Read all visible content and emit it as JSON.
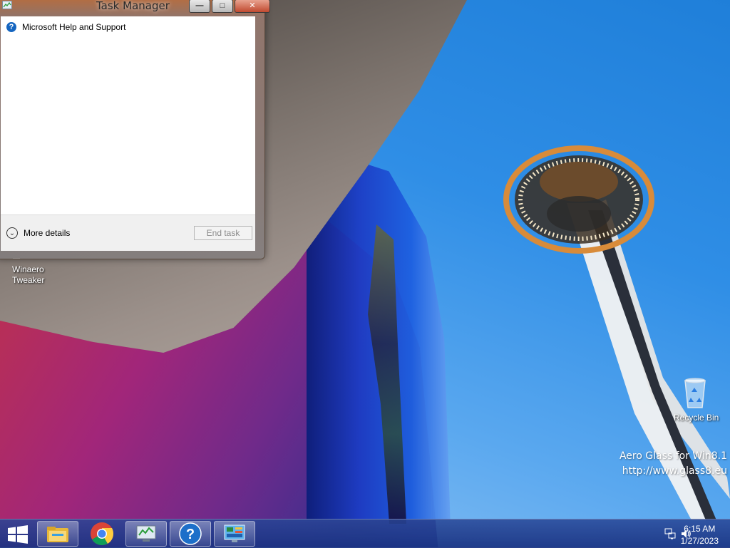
{
  "window": {
    "title": "Task Manager",
    "app_list": [
      {
        "name": "Microsoft Help and Support",
        "icon": "help-icon"
      }
    ],
    "more_details_label": "More details",
    "end_task_label": "End task"
  },
  "desktop_icons": [
    {
      "label_line1": "Winaero",
      "label_line2": "Tweaker",
      "icon": "winaero-tweaker-icon"
    },
    {
      "label": "Recycle Bin",
      "icon": "recycle-bin-icon"
    }
  ],
  "watermark": {
    "line1": "Aero Glass for Win8.1",
    "line2": "http://www.glass8.eu"
  },
  "taskbar": {
    "pinned": [
      "file-explorer-icon",
      "chrome-icon",
      "task-manager-icon",
      "help-support-icon",
      "control-panel-icon"
    ],
    "time": "6:15 AM",
    "date": "1/27/2023",
    "tray_icons": [
      "network-icon",
      "volume-icon"
    ]
  },
  "colors": {
    "taskbar": "#1e3a8a",
    "window_frame": "#9a7a66",
    "help_icon": "#1565c0"
  }
}
